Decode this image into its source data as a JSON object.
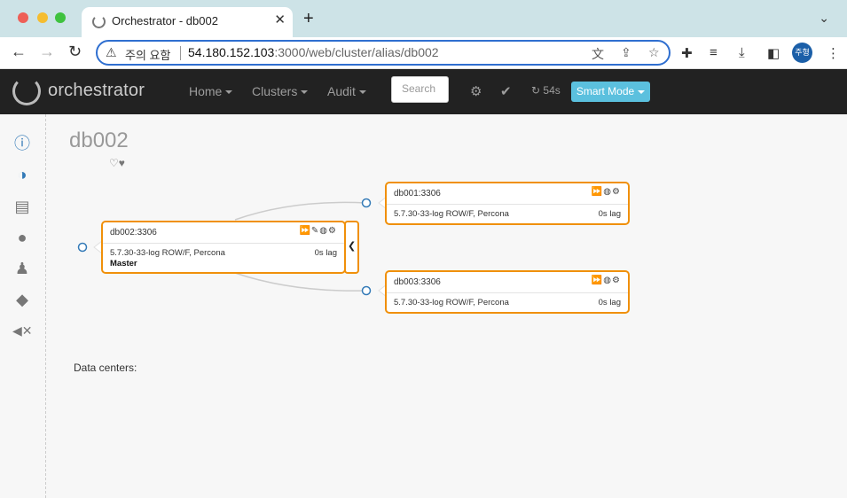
{
  "browser": {
    "tab_title": "Orchestrator - db002",
    "tab_close": "✕",
    "new_tab": "+",
    "security_warning": "주의 요함",
    "url_host": "54.180.152.103",
    "url_path": ":3000/web/cluster/alias/db002",
    "profile_initials": "주형"
  },
  "navbar": {
    "brand": "orchestrator",
    "menus": [
      "Home",
      "Clusters",
      "Audit"
    ],
    "search_placeholder": "Search",
    "refresh_countdown": "54s",
    "smart_mode": "Smart Mode"
  },
  "page": {
    "title": "db002",
    "hearts": "♡♥",
    "data_centers_label": "Data centers:"
  },
  "nodes": [
    {
      "name": "db002:3306",
      "version": "5.7.30-33-log ROW/F, Percona",
      "lag": "0s lag",
      "role": "Master",
      "tools": "⏩✎◍⚙"
    },
    {
      "name": "db001:3306",
      "version": "5.7.30-33-log ROW/F, Percona",
      "lag": "0s lag",
      "role": "",
      "tools": "⏩◍⚙"
    },
    {
      "name": "db003:3306",
      "version": "5.7.30-33-log ROW/F, Percona",
      "lag": "0s lag",
      "role": "",
      "tools": "⏩◍⚙"
    }
  ],
  "colors": {
    "node_border": "#f0900a",
    "navbar_bg": "#222222",
    "smart_mode_bg": "#5bc0de",
    "sidebar_icon": "#337ab7"
  },
  "icons": {
    "sidebar": [
      "info-icon",
      "contrast-icon",
      "server-list-icon",
      "drop-icon",
      "user-icon",
      "tag-icon",
      "mute-icon"
    ]
  }
}
